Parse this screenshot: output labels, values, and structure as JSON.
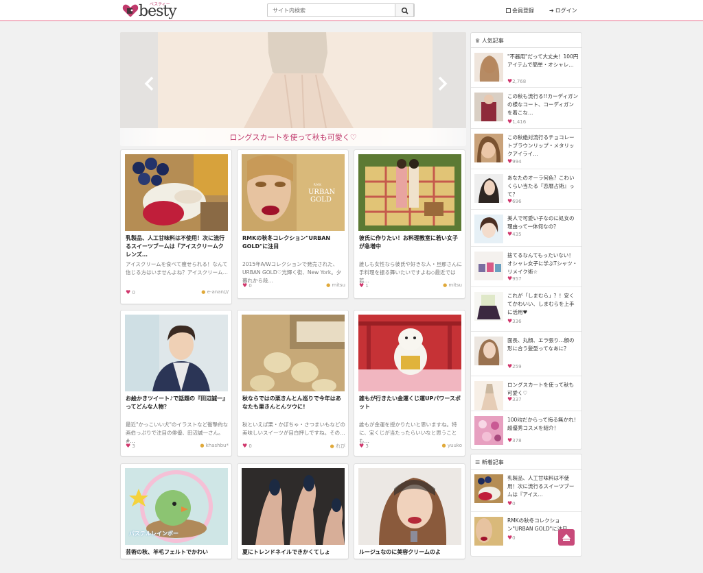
{
  "header": {
    "logo_text": "besty",
    "logo_sub": "ベスティー",
    "search_placeholder": "サイト内検索",
    "register_label": "会員登録",
    "login_label": "ログイン"
  },
  "slider": {
    "caption": "ロングスカートを使って秋も可愛く♡"
  },
  "cards": [
    {
      "title": "乳製品、人工甘味料は不使用！次に流行るスイーツブームは『アイスクリームクレンズ…",
      "excerpt": "アイスクリームを食べて痩せられる！なんて信じる方はいませんよね？アイスクリーム…",
      "likes": "0",
      "author": "e-anan///"
    },
    {
      "title": "RMKの秋冬コレクション\"URBAN GOLD\"に注目",
      "excerpt": "2015年A/Wコレクションで発売された、URBAN GOLD♡光輝く街、New York。夕暮れから段…",
      "likes": "0",
      "author": "mitsu"
    },
    {
      "title": "彼氏に作りたい！お料理教室に若い女子が急増中",
      "excerpt": "誰しも女性なら彼氏や好きな人・旦那さんに手料理を振る舞いたいですよね◇最近では若…",
      "likes": "1",
      "author": "mitsu"
    },
    {
      "title": "お絵かきツイート♪で話題の『田辺誠一』ってどんな人物？",
      "excerpt": "最近\"かっこいい犬\"のイラストなど衝撃的な画伯っぷりで注目の俳優、田辺誠一さん。#…",
      "likes": "3",
      "author": "khashbu*"
    },
    {
      "title": "秋ならではの栗きんとん巡りで今年はあなたも栗きんとんツウに!",
      "excerpt": "秋といえば栗・かぼちゃ・さつまいもなどの美味しいスイーツが目白押しですね。その…",
      "likes": "0",
      "author": "れび"
    },
    {
      "title": "誰もが行きたい金運くじ運UPパワースポット",
      "excerpt": "誰もが金運を授かりたいと思いますね。特に、宝くじが当たったらいいなと思うことも…",
      "likes": "3",
      "author": "yuuko"
    },
    {
      "title": "芸術の秋、羊毛フェルトでかわい",
      "excerpt": "",
      "likes": "",
      "author": ""
    },
    {
      "title": "夏にトレンドネイルできかくてしょ",
      "excerpt": "",
      "likes": "",
      "author": ""
    },
    {
      "title": "ルージュなのに美容クリームのよ",
      "excerpt": "",
      "likes": "",
      "author": ""
    }
  ],
  "thumb_labels": {
    "urban_brand": "RMK",
    "urban_line1": "URBAN",
    "urban_line2": "GOLD",
    "felt_text": "パステルレインボー"
  },
  "popular": {
    "heading": "人気記事",
    "items": [
      {
        "title": "\"不器用\"だって大丈夫！100円アイテムで簡単・オシャレ…",
        "count": "2,768"
      },
      {
        "title": "この秋も流行る!!カーディガンの様なコート、コーディガンを着こな…",
        "count": "1,416"
      },
      {
        "title": "この秋絶対流行るチョコレートブラウンリップ・メタリックアイライ…",
        "count": "994"
      },
      {
        "title": "あなたのオーラ何色？こわいくらい当たる『恋暦占術』って？",
        "count": "696"
      },
      {
        "title": "美人で可愛い子なのに処女の理由って一体何なの？",
        "count": "435"
      },
      {
        "title": "捨てるなんてもったいない！オシャレ女子に学ぶTシャツ・リメイク術☆",
        "count": "957"
      },
      {
        "title": "これが「しまむら」？！安くてかわいい、しまむらを上手に活用♥",
        "count": "336"
      },
      {
        "title": "面長、丸顔、エラ張り…顔の形に合う髪型ってなあに？",
        "count": "259"
      },
      {
        "title": "ロングスカートを使って秋も可愛く♡",
        "count": "337"
      },
      {
        "title": "100均だからって侮る無かれ！超優秀コスメを紹介！",
        "count": "378"
      }
    ]
  },
  "newest": {
    "heading": "新着記事",
    "items": [
      {
        "title": "乳製品、人工甘味料は不使用！次に流行るスイーツブームは『アイス…",
        "count": "0"
      },
      {
        "title": "RMKの秋冬コレクション\"URBAN GOLD\"に注目",
        "count": "0"
      }
    ]
  },
  "colors": {
    "accent": "#c03a6c",
    "heart": "#d0356b",
    "topbar_border": "#f4b7c6"
  },
  "icons": [
    "logo-heart-icon",
    "search-icon",
    "register-icon",
    "login-icon",
    "chevron-left-icon",
    "chevron-right-icon",
    "heart-icon",
    "user-icon",
    "crown-icon",
    "list-icon",
    "arrow-up-icon"
  ]
}
